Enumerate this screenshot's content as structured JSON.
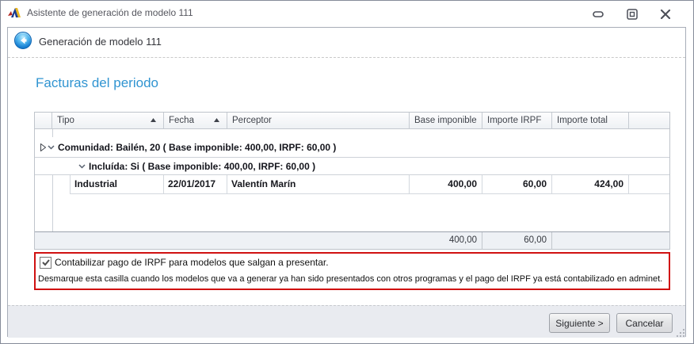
{
  "window": {
    "title": "Asistente de generación de modelo 111"
  },
  "header": {
    "title": "Generación de modelo 111"
  },
  "section": {
    "title": "Facturas del periodo"
  },
  "table": {
    "columns": [
      {
        "label": "Tipo",
        "sort_asc": true
      },
      {
        "label": "Fecha",
        "sort_asc": true
      },
      {
        "label": "Perceptor",
        "sort_asc": false
      },
      {
        "label": "Base imponible",
        "sort_asc": false
      },
      {
        "label": "Importe IRPF",
        "sort_asc": false
      },
      {
        "label": "Importe total",
        "sort_asc": false
      }
    ],
    "group1": {
      "label": "Comunidad: Bailén, 20 ( Base imponible: 400,00,  IRPF: 60,00 )",
      "expanded": true
    },
    "group2": {
      "label": "Incluída: Si ( Base imponible: 400,00,  IRPF: 60,00 )",
      "expanded": true
    },
    "row": {
      "tipo": "Industrial",
      "fecha": "22/01/2017",
      "perceptor": "Valentín Marín",
      "base": "400,00",
      "irpf": "60,00",
      "total": "424,00"
    },
    "summary": {
      "base": "400,00",
      "irpf": "60,00"
    }
  },
  "notice": {
    "checked": true,
    "checkbox_label": "Contabilizar pago de IRPF para modelos que salgan a presentar.",
    "description": "Desmarque esta casilla cuando los modelos que va a generar ya han sido presentados con otros programas y el pago del IRPF ya está contabilizado en adminet."
  },
  "footer": {
    "next_label": "Siguiente >",
    "cancel_label": "Cancelar"
  },
  "colors": {
    "accent_blue": "#3094d1",
    "alert_red": "#d01111",
    "footer_bg": "#e9ebf0"
  }
}
